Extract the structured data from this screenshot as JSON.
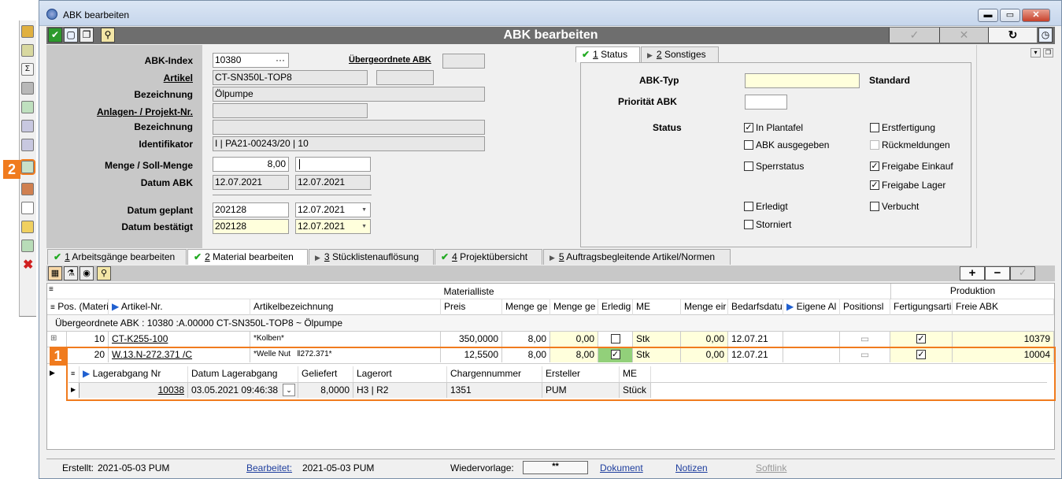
{
  "window": {
    "title": "ABK bearbeiten"
  },
  "header": {
    "title": "ABK bearbeiten"
  },
  "badges": {
    "one": "1",
    "two": "2"
  },
  "form": {
    "abk_index": {
      "label": "ABK-Index",
      "value": "10380",
      "dots": "···"
    },
    "uebergeordnete_abk": {
      "label": "Übergeordnete ABK",
      "value": ""
    },
    "artikel": {
      "label": "Artikel",
      "value": "CT-SN350L-TOP8",
      "extra": ""
    },
    "bezeichnung1": {
      "label": "Bezeichnung",
      "value": "Ölpumpe"
    },
    "anlagen": {
      "label": "Anlagen- / Projekt-Nr.",
      "value": ""
    },
    "bezeichnung2": {
      "label": "Bezeichnung",
      "value": ""
    },
    "identifikator": {
      "label": "Identifikator",
      "value": "I | PA21-00243/20 | 10"
    },
    "menge": {
      "label": "Menge / Soll-Menge",
      "value": "8,00",
      "soll": ""
    },
    "datum_abk": {
      "label": "Datum ABK",
      "value": "12.07.2021",
      "value2": "12.07.2021"
    },
    "datum_geplant": {
      "label": "Datum geplant",
      "value": "202128",
      "date": "12.07.2021"
    },
    "datum_bestaetigt": {
      "label": "Datum bestätigt",
      "value": "202128",
      "date": "12.07.2021"
    }
  },
  "status_tabs": [
    {
      "num": "1",
      "label": " Status"
    },
    {
      "num": "2",
      "label": " Sonstiges"
    }
  ],
  "status": {
    "abk_typ_label": "ABK-Typ",
    "abk_typ_value": "",
    "abk_typ_text": "Standard",
    "prioritaet_label": "Priorität ABK",
    "prioritaet_value": "",
    "status_label": "Status",
    "checks": [
      {
        "label": "In Plantafel",
        "checked": true
      },
      {
        "label": "Erstfertigung",
        "checked": false
      },
      {
        "label": "ABK ausgegeben",
        "checked": false
      },
      {
        "label": "Rückmeldungen",
        "checked": false
      },
      {
        "label": "Sperrstatus",
        "checked": false
      },
      {
        "label": "Freigabe Einkauf",
        "checked": true
      },
      {
        "label": "Freigabe Lager",
        "checked": true
      },
      {
        "label": "Erledigt",
        "checked": false
      },
      {
        "label": "Verbucht",
        "checked": false
      },
      {
        "label": "Storniert",
        "checked": false
      }
    ]
  },
  "bottom_tabs": [
    {
      "num": "1",
      "label": " Arbeitsgänge bearbeiten",
      "icon": "check"
    },
    {
      "num": "2",
      "label": " Material bearbeiten",
      "icon": "check"
    },
    {
      "num": "3",
      "label": " Stücklistenauflösung",
      "icon": "arrow"
    },
    {
      "num": "4",
      "label": " Projektübersicht",
      "icon": "check"
    },
    {
      "num": "5",
      "label": " Auftragsbegleitende Artikel/Normen",
      "icon": "arrow"
    }
  ],
  "grid": {
    "band_materialliste": "Materialliste",
    "band_produktion": "Produktion",
    "columns": [
      "Pos. (Materi",
      "Artikel-Nr.",
      "Artikelbezeichnung",
      "Preis",
      "Menge ge",
      "Menge ge",
      "Erledig",
      "ME",
      "Menge eir",
      "Bedarfsdatu",
      "Eigene Al",
      "Positionsl",
      "Fertigungsarti",
      "Freie ABK"
    ],
    "group_row": "Übergeordnete ABK :  10380 :A.00000 CT-SN350L-TOP8 ~ Ölpumpe",
    "rows": [
      {
        "pos": "10",
        "artikel": "CT-K255-100",
        "bez": "*Kolben*",
        "bez2": "",
        "preis": "350,0000",
        "m1": "8,00",
        "m2": "0,00",
        "erledigt": false,
        "me": "Stk",
        "m3": "0,00",
        "datum": "12.07.21",
        "eigene": "",
        "freie": "10379",
        "expander": "⊞"
      },
      {
        "pos": "20",
        "artikel": "W.13.N-272.371 /C",
        "bez": "*Welle Nut",
        "bez2": "272.371*",
        "preis": "12,5500",
        "m1": "8,00",
        "m2": "8,00",
        "erledigt": true,
        "me": "Stk",
        "m3": "0,00",
        "datum": "12.07.21",
        "eigene": "",
        "freie": "10004",
        "expander": "⊟"
      }
    ],
    "sub": {
      "columns": [
        "Lagerabgang Nr",
        "Datum Lagerabgang",
        "Geliefert",
        "Lagerort",
        "Chargennummer",
        "Ersteller",
        "ME"
      ],
      "row": {
        "nr": "10038",
        "datum": "03.05.2021 09:46:38",
        "geliefert": "8,0000",
        "lagerort": "H3 | R2",
        "charge": "1351",
        "ersteller": "PUM",
        "me": "Stück"
      }
    }
  },
  "statusbar": {
    "erstellt_label": "Erstellt:",
    "erstellt_value": "2021-05-03  PUM",
    "bearbeitet_label": "Bearbeitet:",
    "bearbeitet_value": "2021-05-03  PUM",
    "wiedervorlage_label": "Wiedervorlage:",
    "wiedervorlage_value": "**",
    "dokument": "Dokument",
    "notizen": "Notizen",
    "softlink": "Softlink"
  }
}
